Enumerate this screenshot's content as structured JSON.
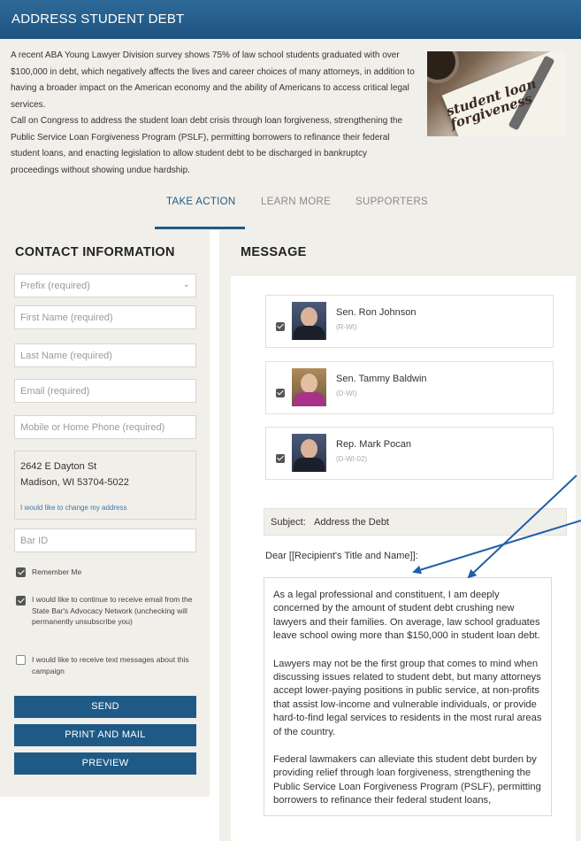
{
  "header": {
    "title": "ADDRESS STUDENT DEBT"
  },
  "intro": {
    "paragraph1": "A recent ABA Young Lawyer Division survey shows 75% of law school students graduated with over $100,000 in debt, which negatively affects the lives and career choices of many attorneys, in addition to having a broader impact on the American economy and the ability of Americans to access critical legal services.",
    "paragraph2": "Call on Congress to address the student loan debt crisis through loan forgiveness, strengthening the Public Service Loan Forgiveness Program (PSLF), permitting borrowers to refinance their federal student loans, and enacting legislation to allow student debt to be discharged in bankruptcy proceedings without showing undue hardship.",
    "image_text": "student loan forgiveness"
  },
  "tabs": [
    {
      "label": "TAKE ACTION",
      "active": true
    },
    {
      "label": "LEARN MORE",
      "active": false
    },
    {
      "label": "SUPPORTERS",
      "active": false
    }
  ],
  "contact": {
    "heading": "CONTACT INFORMATION",
    "prefix_placeholder": "Prefix (required)",
    "first_name_placeholder": "First Name (required)",
    "last_name_placeholder": "Last Name (required)",
    "email_placeholder": "Email (required)",
    "phone_placeholder": "Mobile or Home Phone (required)",
    "address_line1": "2642 E Dayton St",
    "address_line2": "Madison, WI 53704-5022",
    "change_address": "I would like to change my address",
    "bar_id_placeholder": "Bar ID",
    "remember_me": "Remember Me",
    "email_optin": "I would like to continue to receive email from the State Bar's Advocacy Network (unchecking will permanently unsubscribe you)",
    "text_optin": "I would like to receive text messages about this campaign",
    "send": "SEND",
    "print_mail": "PRINT AND MAIL",
    "preview": "PREVIEW"
  },
  "message": {
    "heading": "MESSAGE",
    "recipients": [
      {
        "name": "Sen. Ron Johnson",
        "party": "(R-WI)"
      },
      {
        "name": "Sen. Tammy Baldwin",
        "party": "(D-WI)"
      },
      {
        "name": "Rep. Mark Pocan",
        "party": "(D-WI-02)"
      }
    ],
    "subject_label": "Subject:",
    "subject_value": "Address the Debt",
    "greeting": "Dear [[Recipient's Title and Name]]:",
    "body_p1": "As a legal professional and constituent, I am deeply concerned by the amount of student debt crushing new lawyers and their families. On average, law school graduates leave school owing more than $150,000 in student loan debt.",
    "body_p2": "Lawyers may not be the first group that comes to mind when discussing issues related to student debt, but many attorneys accept lower-paying positions in public service, at non-profits that assist low-income and vulnerable individuals, or provide hard-to-find legal services to residents in the most rural areas of the country.",
    "body_p3": "Federal lawmakers can alleviate this student debt burden by providing relief through loan forgiveness, strengthening the Public Service Loan Forgiveness Program (PSLF), permitting borrowers to refinance their federal student loans,"
  },
  "colors": {
    "primary": "#1f5a86",
    "panel": "#f1efea",
    "annotation": "#1e5fa8"
  }
}
